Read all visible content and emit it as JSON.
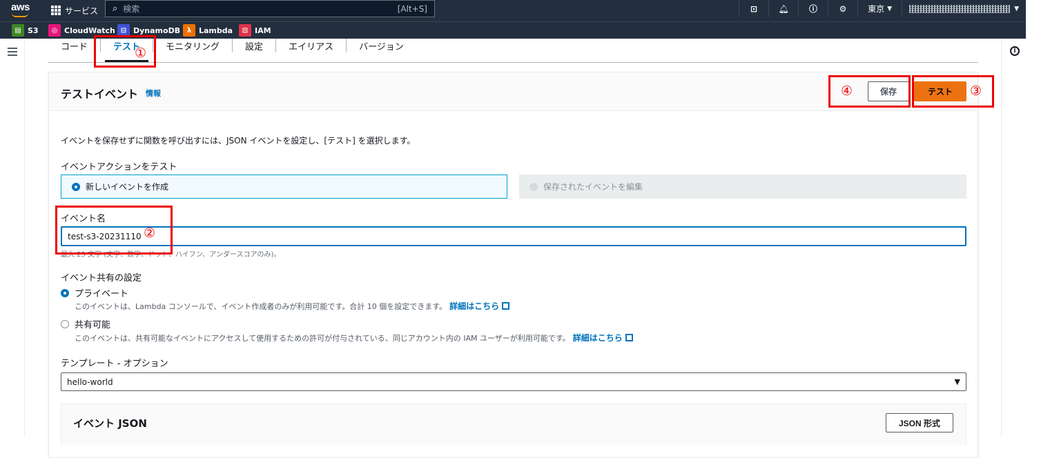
{
  "topbar": {
    "logo": "aws",
    "services_label": "サービス",
    "search_placeholder": "検索",
    "search_shortcut": "[Alt+S]",
    "region": "東京"
  },
  "favorites": [
    {
      "label": "S3",
      "icon": "s3-icon",
      "color": "#3f8624"
    },
    {
      "label": "CloudWatch",
      "icon": "cloudwatch-icon",
      "color": "#e7157b"
    },
    {
      "label": "DynamoDB",
      "icon": "dynamodb-icon",
      "color": "#4053d6"
    },
    {
      "label": "Lambda",
      "icon": "lambda-icon",
      "color": "#ed7100"
    },
    {
      "label": "IAM",
      "icon": "iam-icon",
      "color": "#dd344c"
    }
  ],
  "tabs": [
    "コード",
    "テスト",
    "モニタリング",
    "設定",
    "エイリアス",
    "バージョン"
  ],
  "active_tab": "テスト",
  "panel": {
    "title": "テストイベント",
    "info": "情報",
    "save_label": "保存",
    "test_label": "テスト",
    "description": "イベントを保存せずに関数を呼び出すには、JSON イベントを設定し、[テスト] を選択します。",
    "action_label": "イベントアクションをテスト",
    "choice_new": "新しいイベントを作成",
    "choice_saved": "保存されたイベントを編集",
    "event_name_label": "イベント名",
    "event_name_value": "test-s3-20231110",
    "event_name_hint": "最大 25 文字 (文字、数字、ドット、ハイフン、アンダースコアのみ)。",
    "sharing_label": "イベント共有の設定",
    "private_label": "プライベート",
    "private_desc": "このイベントは、Lambda コンソールで、イベント作成者のみが利用可能です。合計 10 個を設定できます。",
    "shareable_label": "共有可能",
    "shareable_desc": "このイベントは、共有可能なイベントにアクセスして使用するための許可が付与されている、同じアカウント内の IAM ユーザーが利用可能です。",
    "learn_more": "詳細はこちら",
    "template_label": "テンプレート - オプション",
    "template_value": "hello-world",
    "json_title": "イベント JSON",
    "json_format_label": "JSON 形式"
  },
  "annotations": [
    "①",
    "②",
    "③",
    "④"
  ],
  "colors": {
    "accent": "#0073bb",
    "primary_button": "#ec7211",
    "annotation": "#e00000",
    "header": "#232f3e"
  }
}
